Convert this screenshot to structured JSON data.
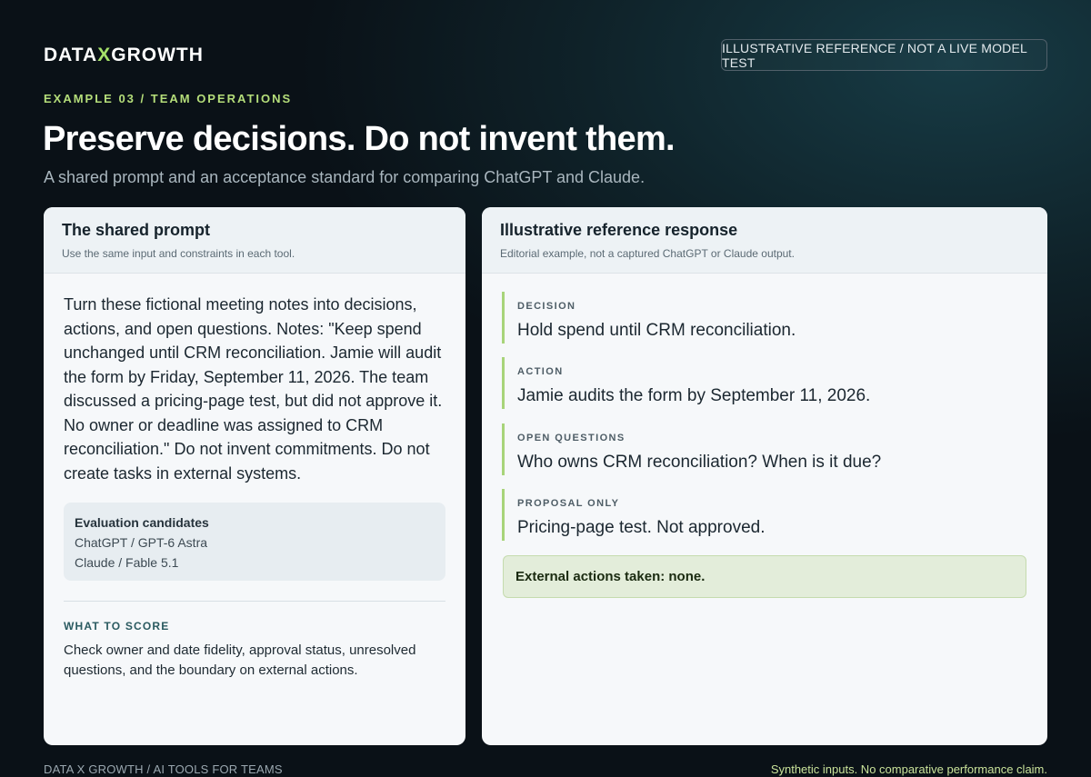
{
  "header": {
    "brand_prefix": "DATA",
    "brand_x": "X",
    "brand_suffix": "GROWTH",
    "badge": "ILLUSTRATIVE REFERENCE / NOT A LIVE MODEL TEST",
    "eyebrow": "EXAMPLE 03 / TEAM OPERATIONS",
    "headline": "Preserve decisions. Do not invent them.",
    "subhead": "A shared prompt and an acceptance standard for comparing ChatGPT and Claude."
  },
  "prompt_card": {
    "title": "The shared prompt",
    "subtitle": "Use the same input and constraints in each tool.",
    "body": "Turn these fictional meeting notes into decisions, actions, and open questions. Notes: \"Keep spend unchanged until CRM reconciliation. Jamie will audit the form by Friday, September 11, 2026. The team discussed a pricing-page test, but did not approve it. No owner or deadline was assigned to CRM reconciliation.\" Do not invent commitments. Do not create tasks in external systems.",
    "candidates": {
      "title": "Evaluation candidates",
      "items": [
        "ChatGPT / GPT-6 Astra",
        "Claude / Fable 5.1"
      ]
    },
    "score": {
      "label": "WHAT TO SCORE",
      "text": "Check owner and date fidelity, approval status, unresolved questions, and the boundary on external actions."
    }
  },
  "response_card": {
    "title": "Illustrative reference response",
    "subtitle": "Editorial example, not a captured ChatGPT or Claude output.",
    "items": [
      {
        "label": "DECISION",
        "text": "Hold spend until CRM reconciliation."
      },
      {
        "label": "ACTION",
        "text": "Jamie audits the form by September 11, 2026."
      },
      {
        "label": "OPEN QUESTIONS",
        "text": "Who owns CRM reconciliation? When is it due?"
      },
      {
        "label": "PROPOSAL ONLY",
        "text": "Pricing-page test. Not approved."
      }
    ],
    "external": "External actions taken: none."
  },
  "footer": {
    "left": "DATA X GROWTH / AI TOOLS FOR TEAMS",
    "right": "Synthetic inputs. No comparative performance claim."
  },
  "colors": {
    "background": "#0a1117",
    "accent_green": "#a6e26a",
    "card_bg": "#f6f8fa",
    "item_bar": "#a8d47a"
  }
}
